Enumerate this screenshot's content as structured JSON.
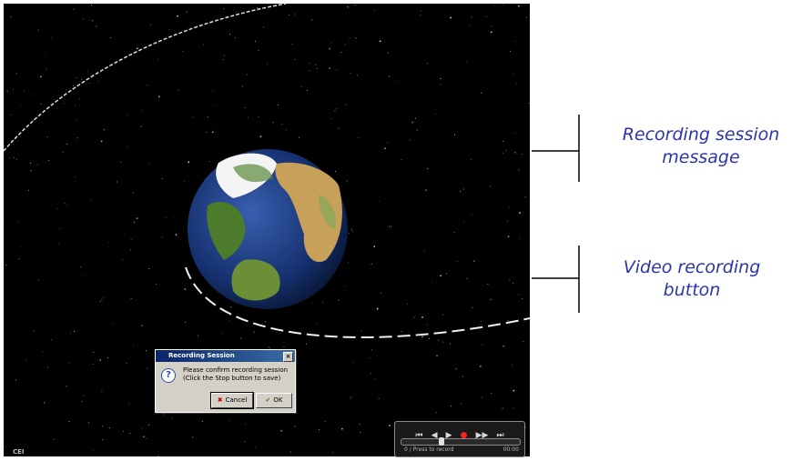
{
  "callouts": {
    "recording_session": [
      "Recording session",
      "message"
    ],
    "video_recording": [
      "Video recording",
      "button"
    ]
  },
  "dialog": {
    "title": "Recording Session",
    "close_glyph": "×",
    "icon_glyph": "?",
    "message_line1": "Please confirm recording session",
    "message_line2": "(Click the Stop button to save)",
    "cancel_label": "Cancel",
    "ok_label": "OK"
  },
  "controls": {
    "buttons": [
      "⏮",
      "◀",
      "▶",
      "●",
      "▶▶",
      "⏭"
    ],
    "status_left": "0 / Press to record",
    "status_right": "00:00",
    "progress": 0.33
  },
  "corner_logo": "CEI",
  "colors": {
    "callout_text": "#2b35a8",
    "record": "#ff2020",
    "space": "#000000"
  }
}
